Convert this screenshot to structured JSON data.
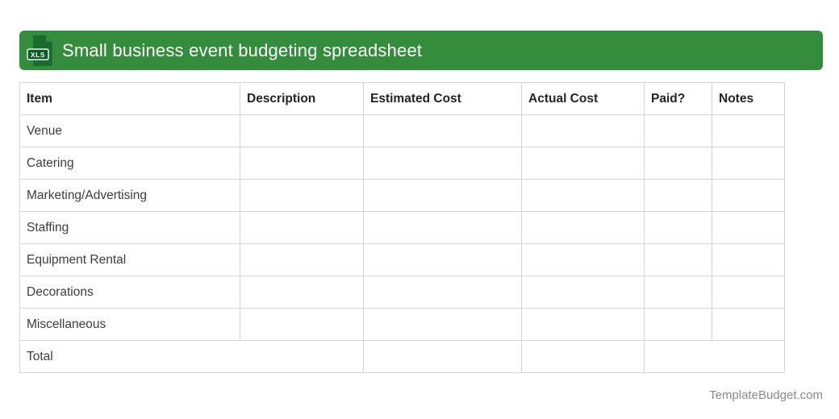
{
  "header": {
    "title": "Small business event budgeting spreadsheet",
    "icon_label": "XLS"
  },
  "colors": {
    "accent_green": "#348c3c",
    "icon_doc_green": "#1a6b31",
    "icon_fold_green": "#2e8b44",
    "icon_badge_green": "#0e5a26",
    "icon_badge_border": "#e8f4ea",
    "table_border": "#d4d4d4",
    "header_text": "#242424",
    "body_text": "#3d3d3d",
    "footer_text": "#8b8b8b"
  },
  "table": {
    "columns": [
      "Item",
      "Description",
      "Estimated Cost",
      "Actual Cost",
      "Paid?",
      "Notes"
    ],
    "rows": [
      {
        "item": "Venue"
      },
      {
        "item": "Catering"
      },
      {
        "item": "Marketing/Advertising"
      },
      {
        "item": "Staffing"
      },
      {
        "item": "Equipment Rental"
      },
      {
        "item": "Decorations"
      },
      {
        "item": "Miscellaneous"
      }
    ],
    "total_label": "Total"
  },
  "footer": {
    "site": "TemplateBudget.com"
  }
}
